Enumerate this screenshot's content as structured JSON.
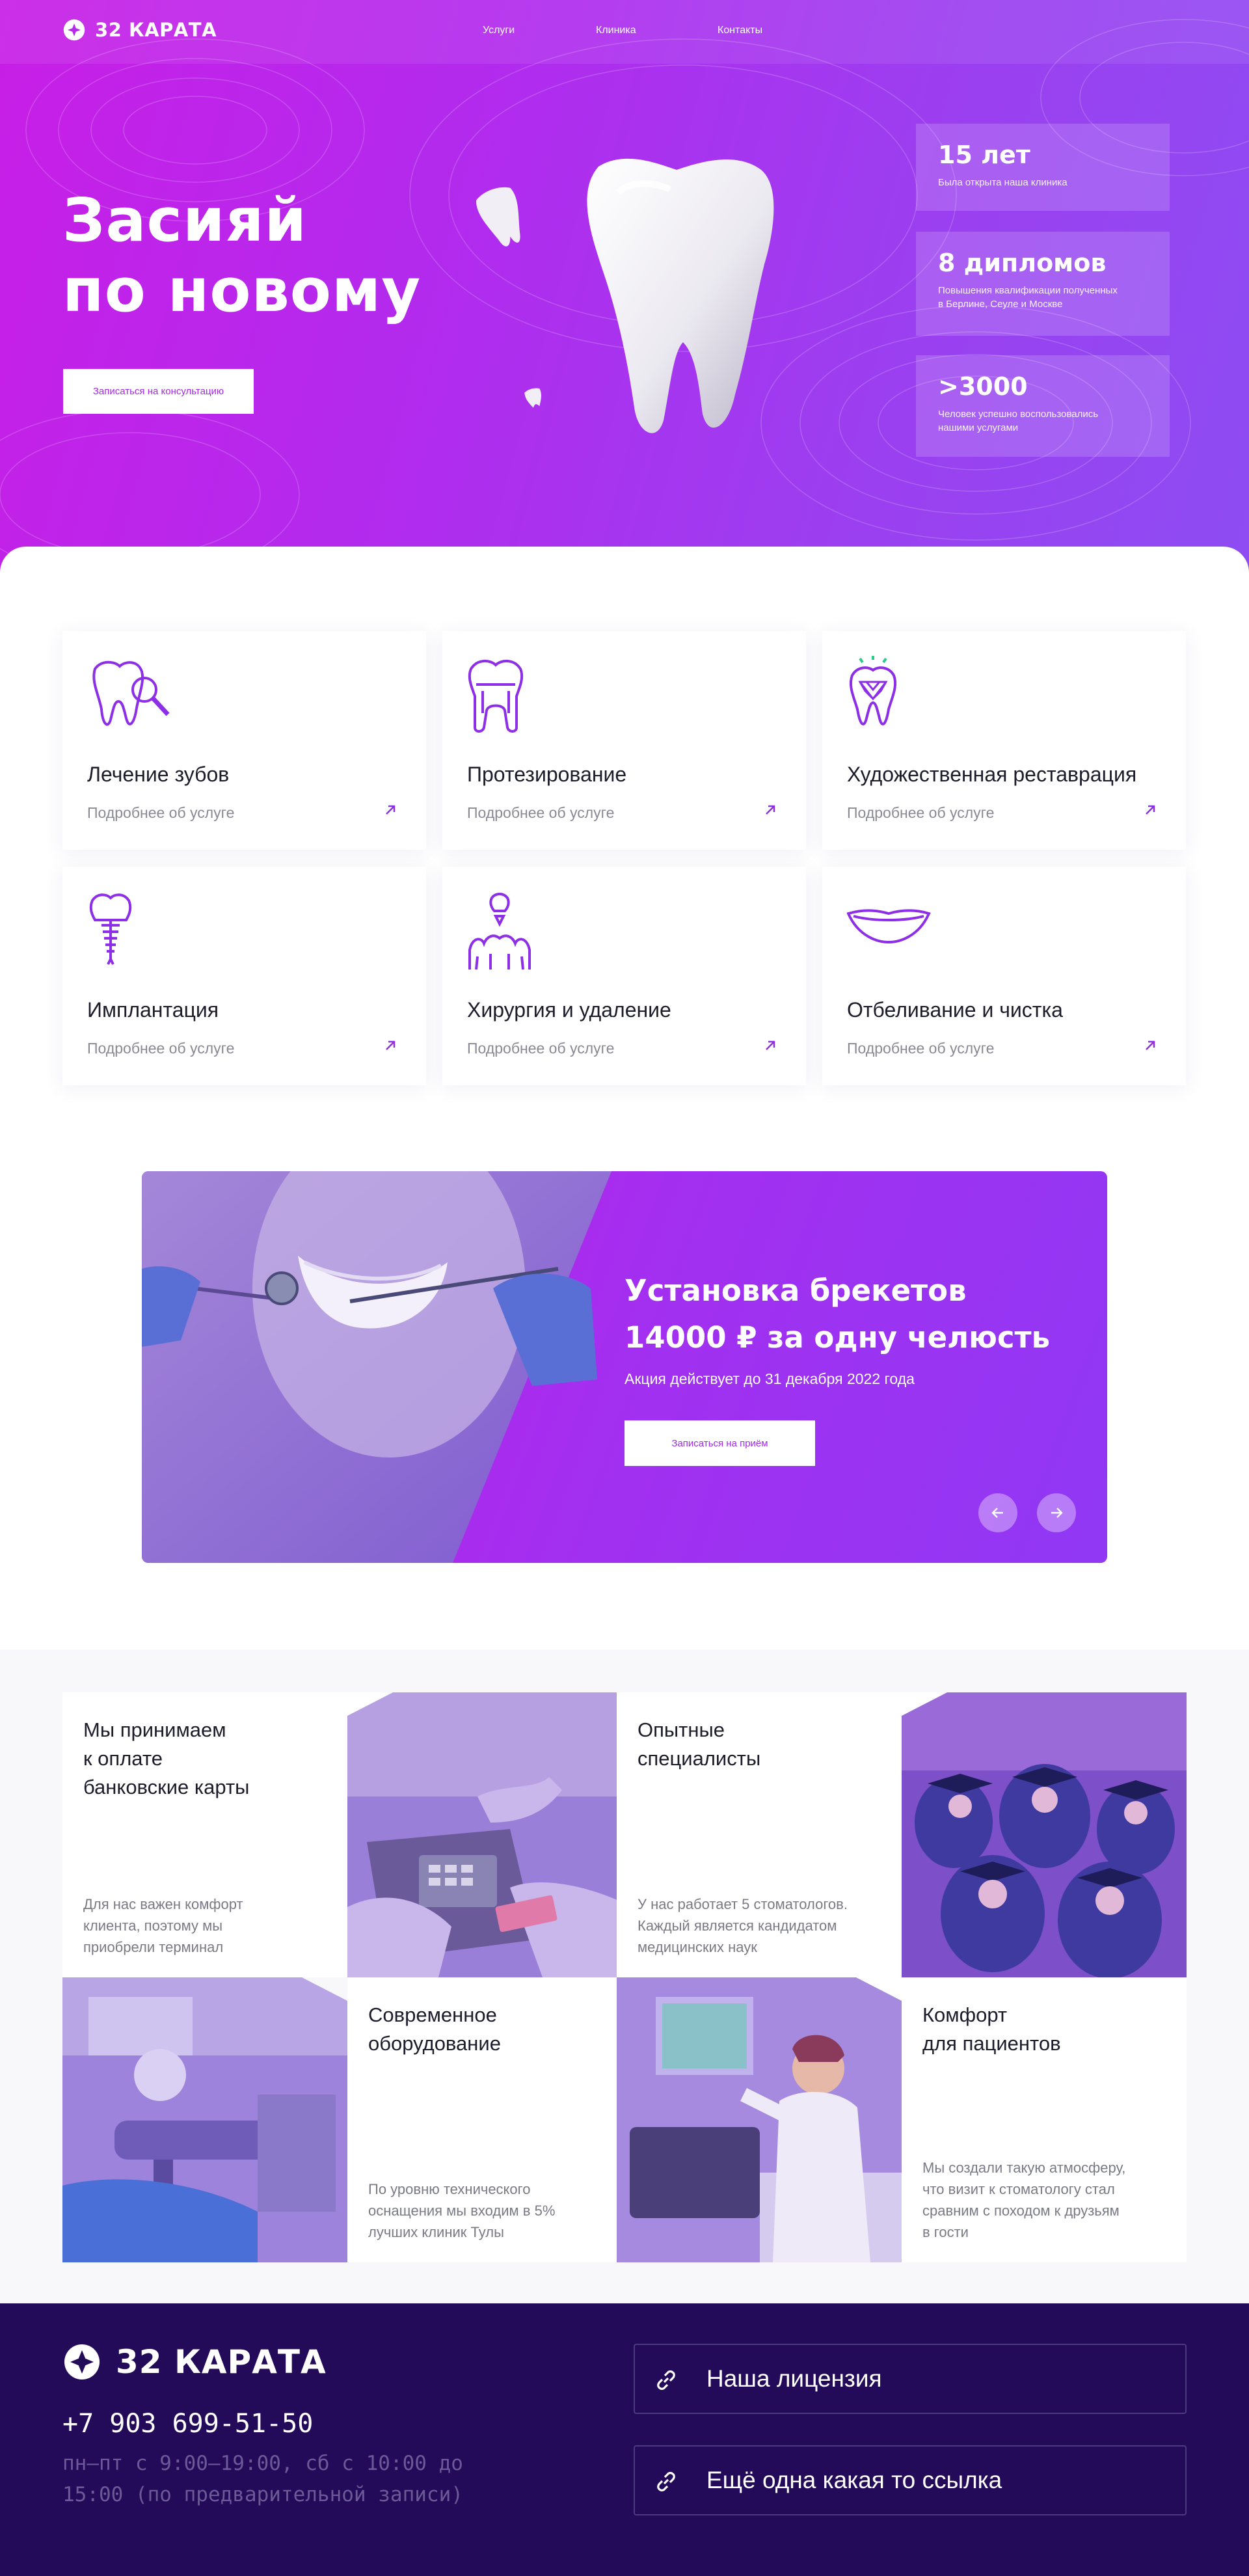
{
  "brand": {
    "name": "32 КАРАТА"
  },
  "nav": {
    "items": [
      "Услуги",
      "Клиника",
      "Контакты"
    ]
  },
  "hero": {
    "title_line1": "Засияй",
    "title_line2": "по новому",
    "cta": "Записаться на консультацию",
    "stats": [
      {
        "value": "15 лет",
        "text": "Была открыта наша клиника"
      },
      {
        "value": "8 дипломов",
        "text_line1": "Повышения квалификации полученных",
        "text_line2": "в Берлине, Сеуле и Москве"
      },
      {
        "value": ">3000",
        "text_line1": "Человек успешно воспользовались",
        "text_line2": "нашими услугами"
      }
    ]
  },
  "services": {
    "more_label": "Подробнее об услуге",
    "items": [
      {
        "title": "Лечение зубов",
        "icon": "tooth-magnifier-icon"
      },
      {
        "title": "Протезирование",
        "icon": "tooth-crown-icon"
      },
      {
        "title": "Художественная реставрация",
        "icon": "tooth-diamond-icon"
      },
      {
        "title": "Имплантация",
        "icon": "implant-icon"
      },
      {
        "title": "Хирургия и удаление",
        "icon": "tooth-extraction-icon"
      },
      {
        "title": "Отбеливание и чистка",
        "icon": "smile-icon"
      }
    ]
  },
  "promo": {
    "title_line1": "Установка брекетов",
    "title_line2": "14000 ₽ за одну челюсть",
    "note": "Акция действует до 31 декабря 2022 года",
    "cta": "Записаться на приём",
    "prev_icon": "arrow-left-icon",
    "next_icon": "arrow-right-icon"
  },
  "features": [
    {
      "title_line1": "Мы принимаем",
      "title_line2": "к оплате",
      "title_line3": "банковские карты",
      "text_line1": "Для нас важен комфорт",
      "text_line2": "клиента, поэтому мы",
      "text_line3": "приобрели терминал"
    },
    {
      "title_line1": "Опытные",
      "title_line2": "специалисты",
      "text_line1": "У нас работает 5 стоматологов.",
      "text_line2": "Каждый является кандидатом",
      "text_line3": "медицинских наук"
    },
    {
      "title_line1": "Современное",
      "title_line2": "оборудование",
      "text_line1": "По уровню технического",
      "text_line2": "оснащения мы входим в 5%",
      "text_line3": "лучших клиник Тулы"
    },
    {
      "title_line1": "Комфорт",
      "title_line2": "для пациентов",
      "text_line1": "Мы создали такую атмосферу,",
      "text_line2": "что визит к стоматологу стал",
      "text_line3": "сравним с походом к друзьям",
      "text_line4": "в гости"
    }
  ],
  "footer": {
    "phone": "+7 903 699-51-50",
    "hours_line1": "пн–пт с 9:00–19:00, сб с 10:00 до",
    "hours_line2": "15:00 (по предварительной записи)",
    "links": [
      "Наша лицензия",
      "Ещё одна какая то ссылка"
    ]
  },
  "colors": {
    "accent": "#a22ae8",
    "hero_start": "#c81ee6",
    "hero_end": "#8e4cf2",
    "footer_bg": "#240b5a"
  }
}
